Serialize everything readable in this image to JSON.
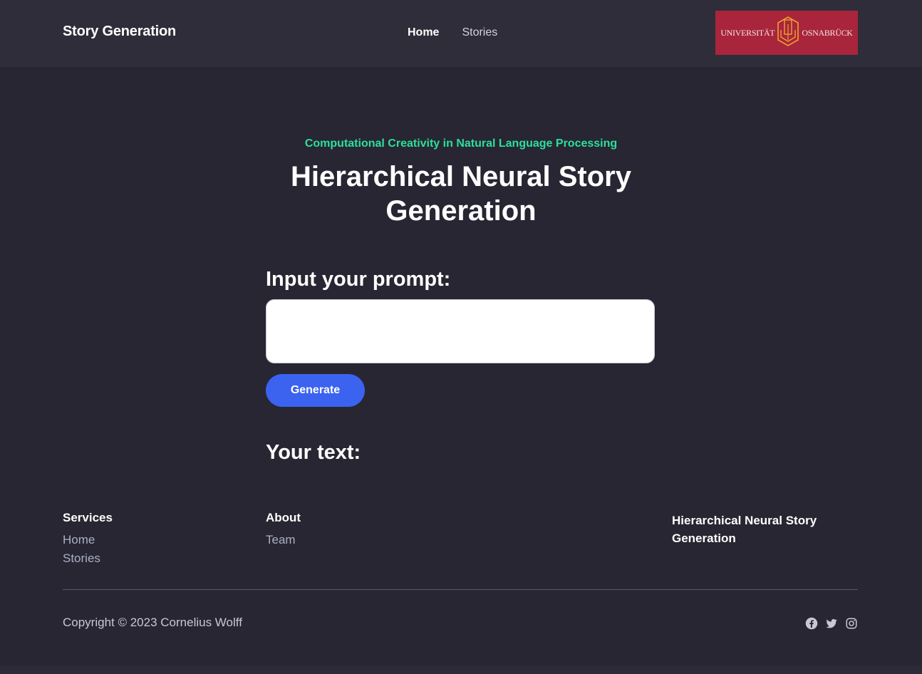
{
  "navbar": {
    "brand": "Story Generation",
    "links": [
      {
        "label": "Home",
        "active": true
      },
      {
        "label": "Stories",
        "active": false
      }
    ],
    "logo": {
      "left_text": "UNIVERSITÄT",
      "right_text": "OSNABRÜCK",
      "background": "#a8253c"
    }
  },
  "hero": {
    "subtitle": "Computational Creativity in Natural Language Processing",
    "title": "Hierarchical Neural Story Generation",
    "accent_color": "#2ddf9c"
  },
  "form": {
    "prompt_label": "Input your prompt:",
    "prompt_value": "",
    "generate_label": "Generate",
    "button_color": "#3b63f0",
    "output_label": "Your text:"
  },
  "footer": {
    "services": {
      "heading": "Services",
      "links": [
        "Home",
        "Stories"
      ]
    },
    "about": {
      "heading": "About",
      "links": [
        "Team"
      ]
    },
    "site_title": "Hierarchical Neural Story Generation",
    "copyright": "Copyright © 2023 Cornelius Wolff",
    "social": [
      "facebook-icon",
      "twitter-icon",
      "instagram-icon"
    ]
  }
}
